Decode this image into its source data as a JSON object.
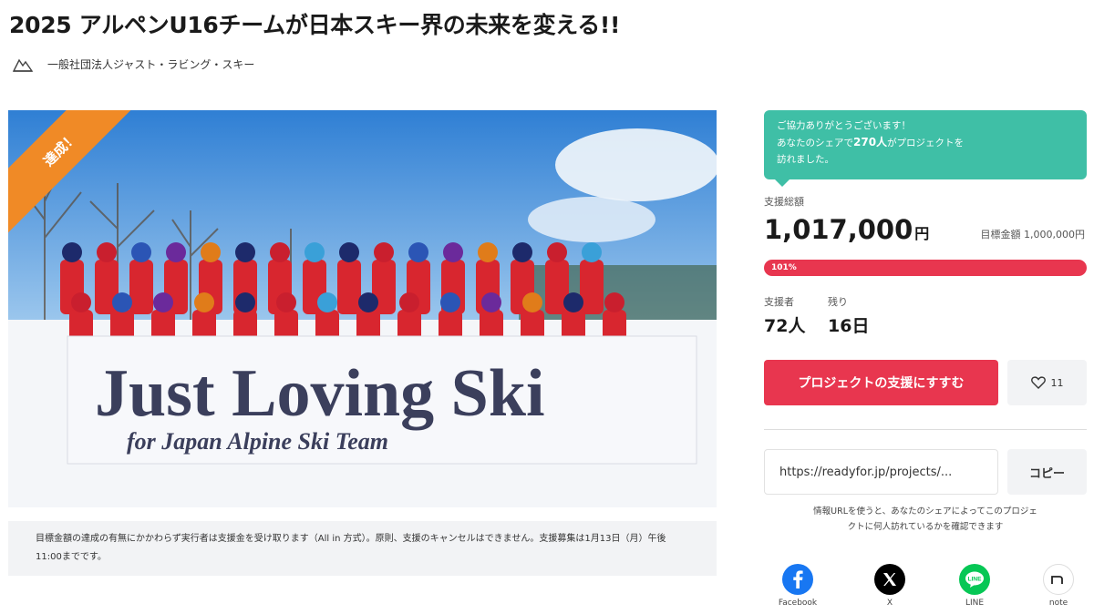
{
  "project": {
    "title": "2025 アルペンU16チームが日本スキー界の未来を変える!!",
    "owner_name": "一般社団法人ジャスト・ラビング・スキー",
    "badge": "達成！",
    "banner_main": "Just Loving Ski",
    "banner_sub": "for Japan Alpine Ski Team",
    "notice": "目標金額の達成の有無にかかわらず実行者は支援金を受け取ります（All in 方式）。原則、支援のキャンセルはできません。支援募集は1月13日（月）午後11:00までです。"
  },
  "sidebar": {
    "thanks_line1": "ご協力ありがとうございます！",
    "thanks_line2_pre": "あなたのシェアで",
    "thanks_line2_count": "270人",
    "thanks_line2_post": "がプロジェクトを",
    "thanks_line3": "訪れました。",
    "raised_label": "支援総額",
    "raised_amount": "1,017,000",
    "raised_unit": "円",
    "goal_text": "目標金額 1,000,000円",
    "progress_text": "101%",
    "progress_percent": 101,
    "supporters_label": "支援者",
    "supporters_value": "72人",
    "remaining_label": "残り",
    "remaining_value": "16日",
    "support_button": "プロジェクトの支援にすすむ",
    "favorite_count": "11",
    "share_url": "https://readyfor.jp/projects/...",
    "copy_button": "コピー",
    "share_note_line1": "情報URLを使うと、あなたのシェアによってこのプロジェ",
    "share_note_line2": "クトに何人訪れているかを確認できます"
  },
  "share": [
    {
      "label": "Facebook",
      "icon": "facebook-icon",
      "color": "#1877f2"
    },
    {
      "label": "X",
      "icon": "x-icon",
      "color": "#000000"
    },
    {
      "label": "LINE",
      "icon": "line-icon",
      "color": "#06c755"
    },
    {
      "label": "note",
      "icon": "note-icon",
      "color": "#ffffff"
    }
  ],
  "colors": {
    "accent": "#e8364f",
    "teal": "#3fbfa6",
    "badge": "#f08a26"
  }
}
